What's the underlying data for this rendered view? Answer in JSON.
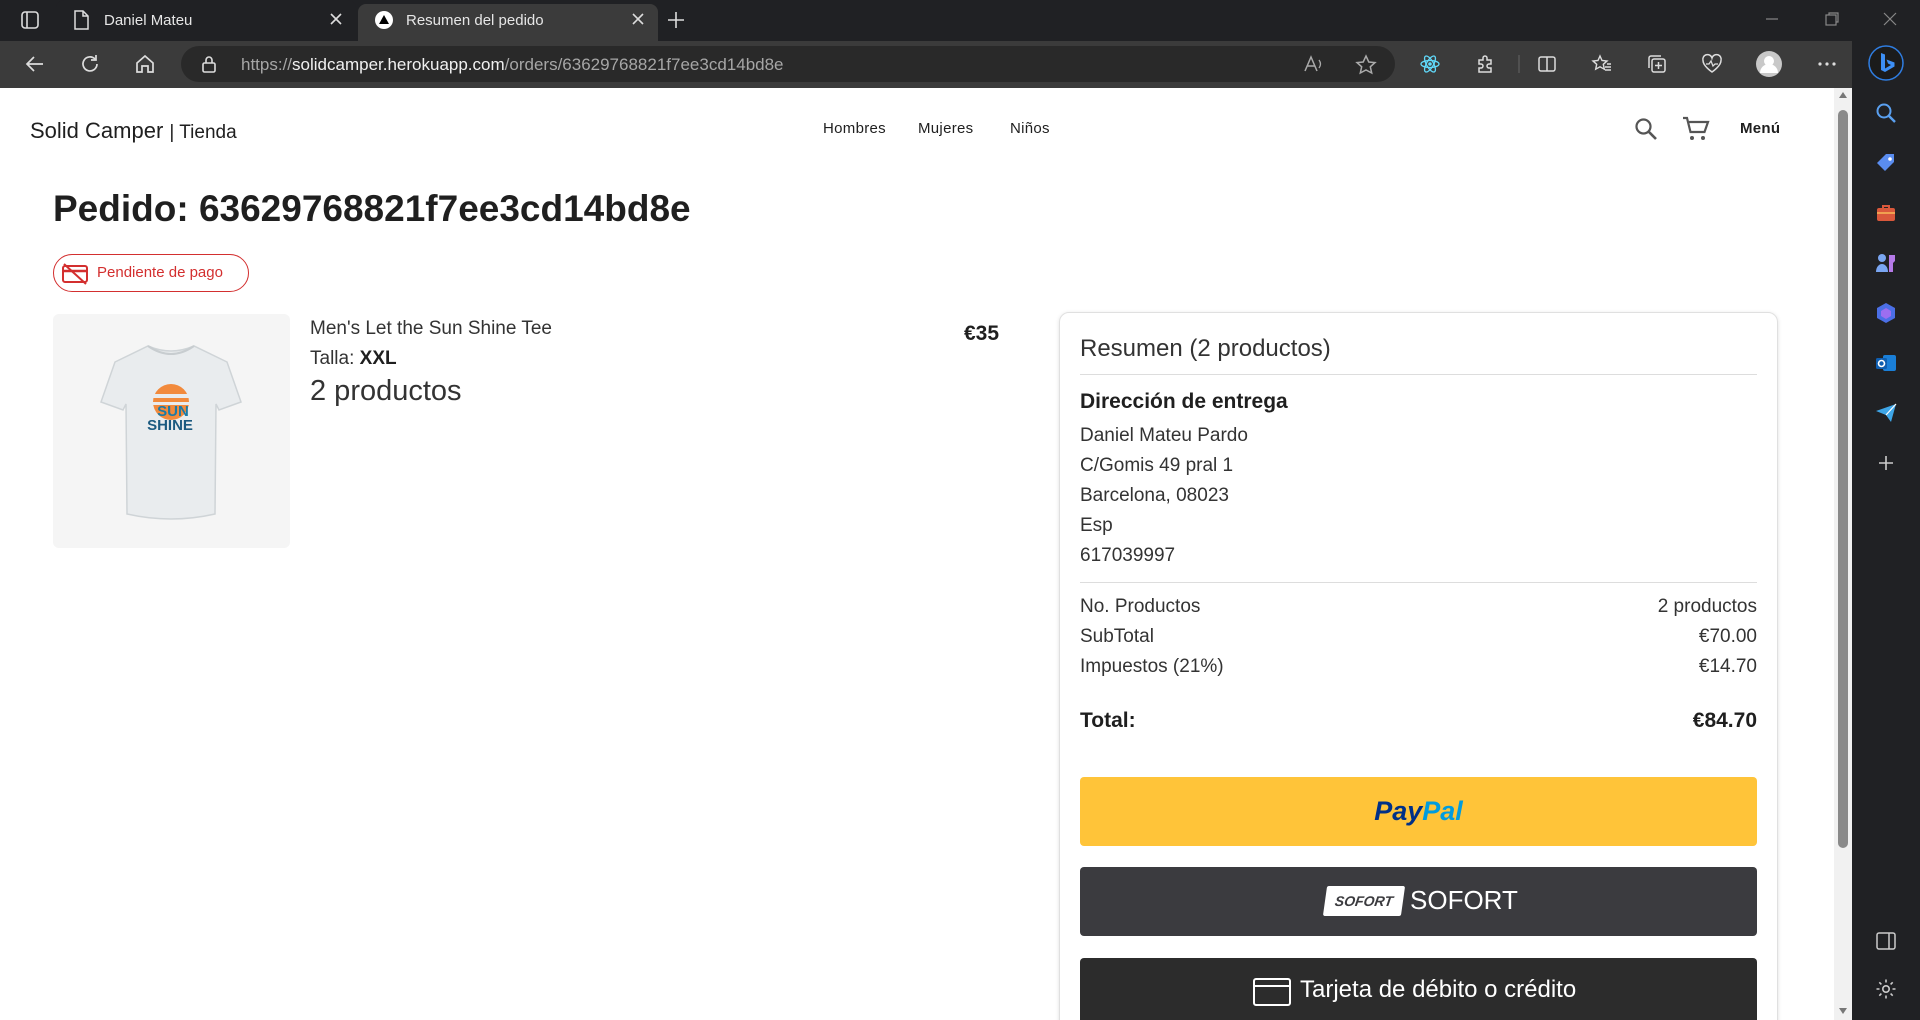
{
  "browser": {
    "tabs": [
      {
        "title": "Daniel Mateu",
        "active": false
      },
      {
        "title": "Resumen del pedido",
        "active": true
      }
    ],
    "url_prefix": "https://",
    "url_domain": "solidcamper.herokuapp.com",
    "url_path": "/orders/63629768821f7ee3cd14bd8e"
  },
  "header": {
    "brand": "Solid Camper",
    "brand_sub": "| Tienda",
    "nav": [
      "Hombres",
      "Mujeres",
      "Niños"
    ],
    "menu_label": "Menú"
  },
  "order": {
    "title": "Pedido: 63629768821f7ee3cd14bd8e",
    "status": "Pendiente de pago",
    "status_color": "#d32f2f"
  },
  "product": {
    "name": "Men's Let the Sun Shine Tee",
    "size_label": "Talla:",
    "size": "XXL",
    "quantity": "2 productos",
    "price": "€35",
    "image_text_1": "SUN",
    "image_text_2": "SHINE"
  },
  "summary": {
    "title": "Resumen (2 productos)",
    "address_heading": "Dirección de entrega",
    "address_lines": [
      "Daniel Mateu Pardo",
      "C/Gomis 49 pral 1",
      "Barcelona, 08023",
      "Esp",
      "617039997"
    ],
    "rows": [
      {
        "label": "No. Productos",
        "value": "2 productos"
      },
      {
        "label": "SubTotal",
        "value": "€70.00"
      },
      {
        "label": "Impuestos (21%)",
        "value": "€14.70"
      }
    ],
    "total_label": "Total:",
    "total_value": "€84.70"
  },
  "payment": {
    "paypal_1": "Pay",
    "paypal_2": "Pal",
    "paypal_color": "#ffc439",
    "sofort_badge": "SOFORT",
    "sofort_label": "SOFORT",
    "card_label": "Tarjeta de débito o crédito"
  }
}
